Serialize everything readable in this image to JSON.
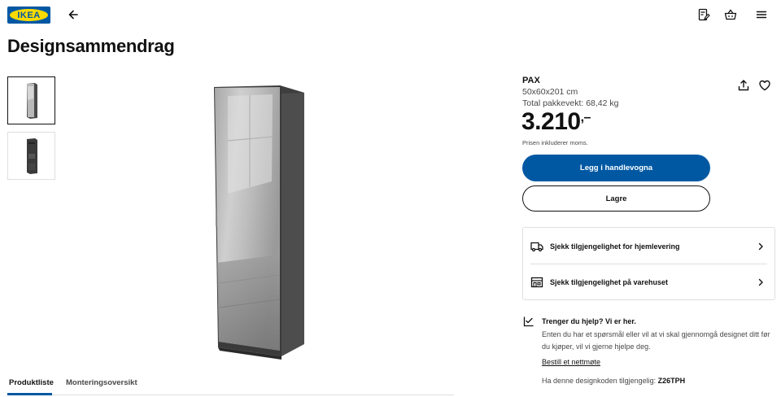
{
  "header": {
    "logo_text": "IKEA",
    "icons": [
      "back-arrow-icon",
      "shopping-list-icon",
      "basket-icon",
      "menu-icon"
    ]
  },
  "page_title": "Designsammendrag",
  "product": {
    "name": "PAX",
    "dimensions": "50x60x201 cm",
    "weight": "Total pakkevekt: 68,42 kg",
    "price": "3.210",
    "price_suffix": ",–",
    "vat_note": "Prisen inkluderer moms."
  },
  "actions": {
    "add_to_cart": "Legg i handlevogna",
    "save": "Lagre"
  },
  "availability": {
    "home_delivery": "Sjekk tilgjengelighet for hjemlevering",
    "store": "Sjekk tilgjengelighet på varehuset"
  },
  "help": {
    "title": "Trenger du hjelp? Vi er her.",
    "text": "Enten du har et spørsmål eller vil at vi skal gjennomgå designet ditt før du kjøper, vil vi gjerne hjelpe deg.",
    "link": "Bestill et nettmøte",
    "code_label": "Ha denne designkoden tilgjengelig:",
    "code": "Z26TPH"
  },
  "tabs": [
    {
      "label": "Produktliste",
      "active": true
    },
    {
      "label": "Monteringsoversikt",
      "active": false
    }
  ],
  "colors": {
    "ikea_blue": "#0058a3",
    "ikea_yellow": "#ffdb00"
  }
}
